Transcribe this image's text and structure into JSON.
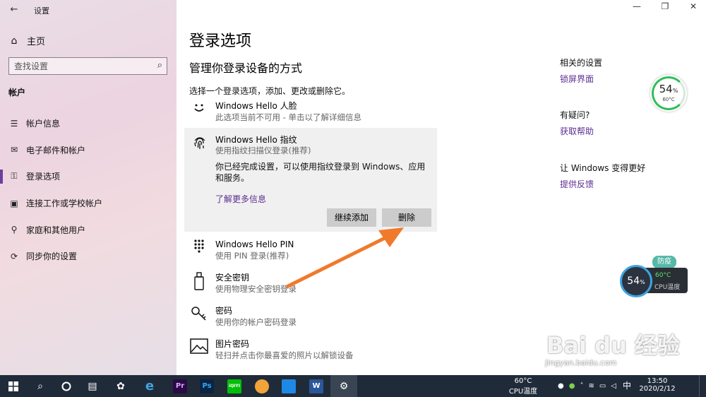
{
  "window": {
    "app_title": "设置",
    "back_label": "←",
    "minimize": "—",
    "restore": "❐",
    "close": "✕"
  },
  "sidebar": {
    "home_label": "主页",
    "search_placeholder": "查找设置",
    "section": "帐户",
    "items": [
      {
        "label": "帐户信息",
        "icon": "person-card-icon"
      },
      {
        "label": "电子邮件和帐户",
        "icon": "mail-icon"
      },
      {
        "label": "登录选项",
        "icon": "key-icon",
        "active": true
      },
      {
        "label": "连接工作或学校帐户",
        "icon": "briefcase-icon"
      },
      {
        "label": "家庭和其他用户",
        "icon": "person-icon"
      },
      {
        "label": "同步你的设置",
        "icon": "sync-icon"
      }
    ]
  },
  "main": {
    "title": "登录选项",
    "subtitle": "管理你登录设备的方式",
    "description": "选择一个登录选项，添加、更改或删除它。",
    "options": [
      {
        "title": "Windows Hello 人脸",
        "desc": "此选项当前不可用 - 单击以了解详细信息",
        "icon": "face-icon"
      },
      {
        "title": "Windows Hello 指纹",
        "desc": "使用指纹扫描仪登录(推荐)",
        "icon": "fingerprint-icon"
      },
      {
        "title": "Windows Hello PIN",
        "desc": "使用 PIN 登录(推荐)",
        "icon": "pin-keypad-icon"
      },
      {
        "title": "安全密钥",
        "desc": "使用物理安全密钥登录",
        "icon": "usb-key-icon"
      },
      {
        "title": "密码",
        "desc": "使用你的帐户密码登录",
        "icon": "password-key-icon"
      },
      {
        "title": "图片密码",
        "desc": "轻扫并点击你最喜爱的照片以解锁设备",
        "icon": "picture-icon"
      }
    ],
    "expanded": {
      "body": "你已经完成设置，可以使用指纹登录到 Windows、应用和服务。",
      "more_link": "了解更多信息",
      "add_button": "继续添加",
      "remove_button": "删除"
    }
  },
  "related": {
    "h1": "相关的设置",
    "l1": "锁屏界面",
    "h2": "有疑问?",
    "l2": "获取帮助",
    "h3": "让 Windows 变得更好",
    "l3": "提供反馈"
  },
  "cpu_gauge": {
    "percent": "54",
    "percent_unit": "%",
    "temp": "60°C"
  },
  "cpu_float": {
    "badge": "防疫",
    "percent": "54",
    "percent_unit": "%",
    "temp": "60°C",
    "label": "CPU温度"
  },
  "watermark": {
    "brand": "Bai du 经验",
    "url": "jingyan.baidu.com"
  },
  "taskbar": {
    "apps": [
      "start-icon",
      "search-icon",
      "cortana-icon",
      "task-view-icon",
      "pinwheel-icon",
      "ie-icon",
      "premiere-icon",
      "photoshop-icon",
      "iqiyi-icon",
      "browser-icon",
      "tablet-icon",
      "word-icon",
      "settings-icon"
    ],
    "pr_label": "Pr",
    "ps_label": "Ps",
    "iqiyi_label": "iQIYI",
    "word_label": "W",
    "cpu_temp": "60°C",
    "cpu_label": "CPU温度",
    "ime": "中",
    "time": "13:50",
    "date": "2020/2/12"
  },
  "colors": {
    "accent": "#5c2d91",
    "arrow": "#f07a2c",
    "taskbar": "#202b3a"
  }
}
